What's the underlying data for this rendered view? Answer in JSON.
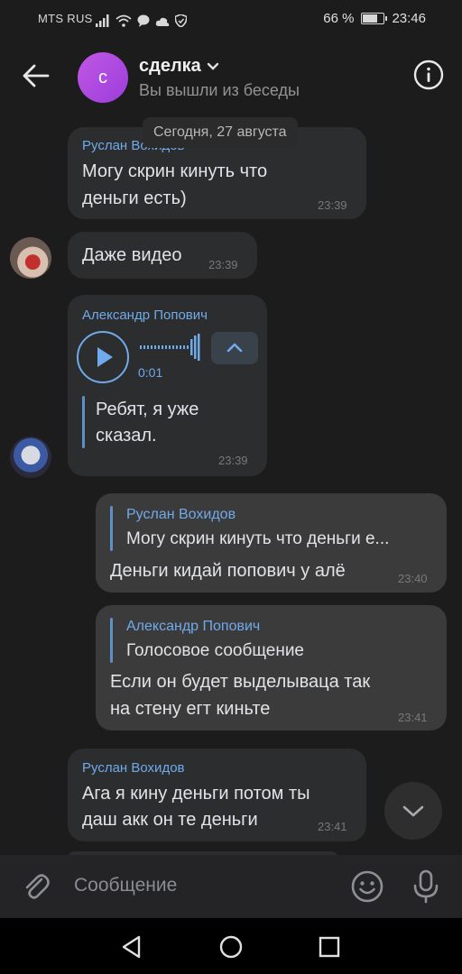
{
  "status_bar": {
    "carrier": "MTS RUS",
    "battery": "66 %",
    "time": "23:46"
  },
  "header": {
    "avatar_letter": "с",
    "title": "сделка",
    "subtitle": "Вы вышли из беседы"
  },
  "date_separator": "Сегодня, 27 августа",
  "messages": [
    {
      "author": "Руслан Вохидов",
      "lines": [
        "Могу скрин кинуть что",
        "деньги есть)"
      ],
      "time": "23:39"
    },
    {
      "text": "Даже видео",
      "time": "23:39"
    },
    {
      "author": "Александр Попович",
      "voice_duration": "0:01",
      "transcript": [
        "Ребят, я уже",
        "сказал."
      ],
      "time": "23:39"
    },
    {
      "reply_author": "Руслан Вохидов",
      "reply_text": "Могу скрин кинуть что деньги е...",
      "text": "Деньги кидай попович у алё",
      "time": "23:40"
    },
    {
      "reply_author": "Александр Попович",
      "reply_text": "Голосовое сообщение",
      "lines": [
        "Если он будет выделываца так",
        "на стену егт киньте"
      ],
      "time": "23:41"
    },
    {
      "author": "Руслан Вохидов",
      "lines": [
        "Ага я кину деньги потом ты",
        "даш акк он те деньги"
      ],
      "time": "23:41"
    }
  ],
  "composer": {
    "placeholder": "Сообщение"
  },
  "colors": {
    "background": "#1c1c1d",
    "bubble": "#2c2d2e",
    "accent": "#71aaeb",
    "avatar": "#b24be0"
  },
  "icons": [
    "back-arrow-icon",
    "chevron-down-icon",
    "info-icon",
    "play-icon",
    "chevron-up-icon",
    "attach-icon",
    "emoji-icon",
    "mic-icon",
    "nav-back-icon",
    "nav-home-icon",
    "nav-recents-icon"
  ]
}
